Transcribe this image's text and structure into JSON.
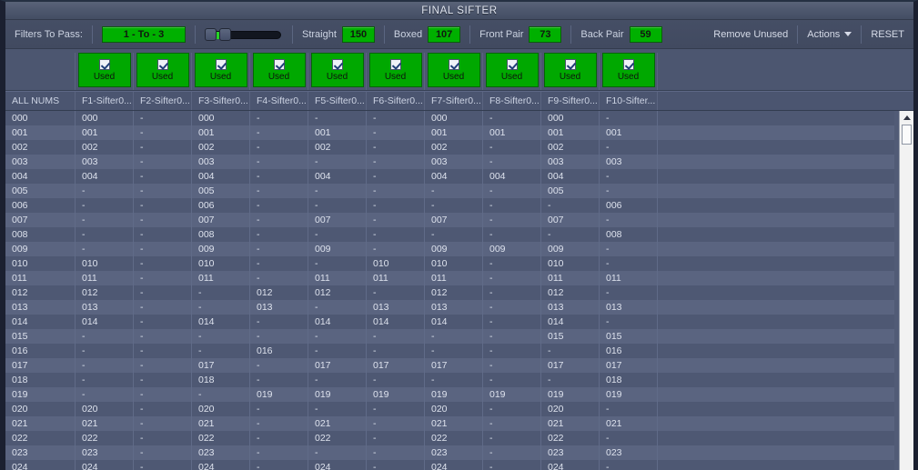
{
  "window": {
    "title": "FINAL SIFTER"
  },
  "toolbar": {
    "filters_label": "Filters To Pass:",
    "filters_value": "1 - To - 3",
    "slider": {
      "name": "filters-range-slider",
      "min_handle": 1,
      "max_handle": 3
    },
    "stats": [
      {
        "label": "Straight",
        "value": "150"
      },
      {
        "label": "Boxed",
        "value": "107"
      },
      {
        "label": "Front Pair",
        "value": "73"
      },
      {
        "label": "Back Pair",
        "value": "59"
      }
    ],
    "remove_unused": "Remove Unused",
    "actions": "Actions",
    "reset": "RESET"
  },
  "used_band": {
    "checkbox_label": "Used",
    "checked": [
      true,
      true,
      true,
      true,
      true,
      true,
      true,
      true,
      true,
      true
    ]
  },
  "grid": {
    "headers": [
      "ALL NUMS",
      "F1-Sifter0...",
      "F2-Sifter0...",
      "F3-Sifter0...",
      "F4-Sifter0...",
      "F5-Sifter0...",
      "F6-Sifter0...",
      "F7-Sifter0...",
      "F8-Sifter0...",
      "F9-Sifter0...",
      "F10-Sifter..."
    ],
    "empty_marker": "-",
    "rows": [
      [
        "000",
        "000",
        "-",
        "000",
        "-",
        "-",
        "-",
        "000",
        "-",
        "000",
        "-"
      ],
      [
        "001",
        "001",
        "-",
        "001",
        "-",
        "001",
        "-",
        "001",
        "001",
        "001",
        "001"
      ],
      [
        "002",
        "002",
        "-",
        "002",
        "-",
        "002",
        "-",
        "002",
        "-",
        "002",
        "-"
      ],
      [
        "003",
        "003",
        "-",
        "003",
        "-",
        "-",
        "-",
        "003",
        "-",
        "003",
        "003"
      ],
      [
        "004",
        "004",
        "-",
        "004",
        "-",
        "004",
        "-",
        "004",
        "004",
        "004",
        "-"
      ],
      [
        "005",
        "-",
        "-",
        "005",
        "-",
        "-",
        "-",
        "-",
        "-",
        "005",
        "-"
      ],
      [
        "006",
        "-",
        "-",
        "006",
        "-",
        "-",
        "-",
        "-",
        "-",
        "-",
        "006"
      ],
      [
        "007",
        "-",
        "-",
        "007",
        "-",
        "007",
        "-",
        "007",
        "-",
        "007",
        "-"
      ],
      [
        "008",
        "-",
        "-",
        "008",
        "-",
        "-",
        "-",
        "-",
        "-",
        "-",
        "008"
      ],
      [
        "009",
        "-",
        "-",
        "009",
        "-",
        "009",
        "-",
        "009",
        "009",
        "009",
        "-"
      ],
      [
        "010",
        "010",
        "-",
        "010",
        "-",
        "-",
        "010",
        "010",
        "-",
        "010",
        "-"
      ],
      [
        "011",
        "011",
        "-",
        "011",
        "-",
        "011",
        "011",
        "011",
        "-",
        "011",
        "011"
      ],
      [
        "012",
        "012",
        "-",
        "-",
        "012",
        "012",
        "-",
        "012",
        "-",
        "012",
        "-"
      ],
      [
        "013",
        "013",
        "-",
        "-",
        "013",
        "-",
        "013",
        "013",
        "-",
        "013",
        "013"
      ],
      [
        "014",
        "014",
        "-",
        "014",
        "-",
        "014",
        "014",
        "014",
        "-",
        "014",
        "-"
      ],
      [
        "015",
        "-",
        "-",
        "-",
        "-",
        "-",
        "-",
        "-",
        "-",
        "015",
        "015"
      ],
      [
        "016",
        "-",
        "-",
        "-",
        "016",
        "-",
        "-",
        "-",
        "-",
        "-",
        "016"
      ],
      [
        "017",
        "-",
        "-",
        "017",
        "-",
        "017",
        "017",
        "017",
        "-",
        "017",
        "017"
      ],
      [
        "018",
        "-",
        "-",
        "018",
        "-",
        "-",
        "-",
        "-",
        "-",
        "-",
        "018"
      ],
      [
        "019",
        "-",
        "-",
        "-",
        "019",
        "019",
        "019",
        "019",
        "019",
        "019",
        "019"
      ],
      [
        "020",
        "020",
        "-",
        "020",
        "-",
        "-",
        "-",
        "020",
        "-",
        "020",
        "-"
      ],
      [
        "021",
        "021",
        "-",
        "021",
        "-",
        "021",
        "-",
        "021",
        "-",
        "021",
        "021"
      ],
      [
        "022",
        "022",
        "-",
        "022",
        "-",
        "022",
        "-",
        "022",
        "-",
        "022",
        "-"
      ],
      [
        "023",
        "023",
        "-",
        "023",
        "-",
        "-",
        "-",
        "023",
        "-",
        "023",
        "023"
      ],
      [
        "024",
        "024",
        "-",
        "024",
        "-",
        "024",
        "-",
        "024",
        "-",
        "024",
        "-"
      ]
    ]
  },
  "colors": {
    "accent_green": "#00b000",
    "panel": "#4a5570",
    "row_odd": "#5a6480",
    "row_even": "#4e5873",
    "text": "#dde2ed"
  }
}
